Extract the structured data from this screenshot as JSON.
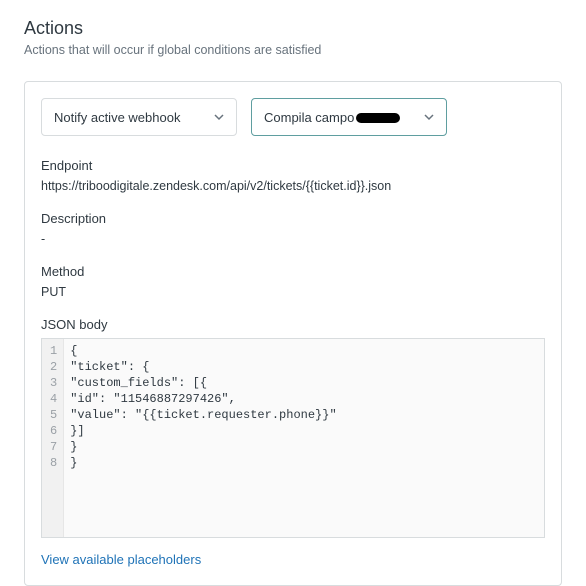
{
  "header": {
    "title": "Actions",
    "subtitle": "Actions that will occur if global conditions are satisfied"
  },
  "panel": {
    "select_action": "Notify active webhook",
    "select_target": "Compila campo",
    "endpoint": {
      "label": "Endpoint",
      "value": "https://triboodigitale.zendesk.com/api/v2/tickets/{{ticket.id}}.json"
    },
    "description": {
      "label": "Description",
      "value": "-"
    },
    "method": {
      "label": "Method",
      "value": "PUT"
    },
    "json_body": {
      "label": "JSON body",
      "lines": [
        "{",
        "\"ticket\": {",
        "\"custom_fields\": [{",
        "\"id\": \"11546887297426\",",
        "\"value\": \"{{ticket.requester.phone}}\"",
        "}]",
        "}",
        "}"
      ]
    },
    "placeholders_link": "View available placeholders"
  }
}
